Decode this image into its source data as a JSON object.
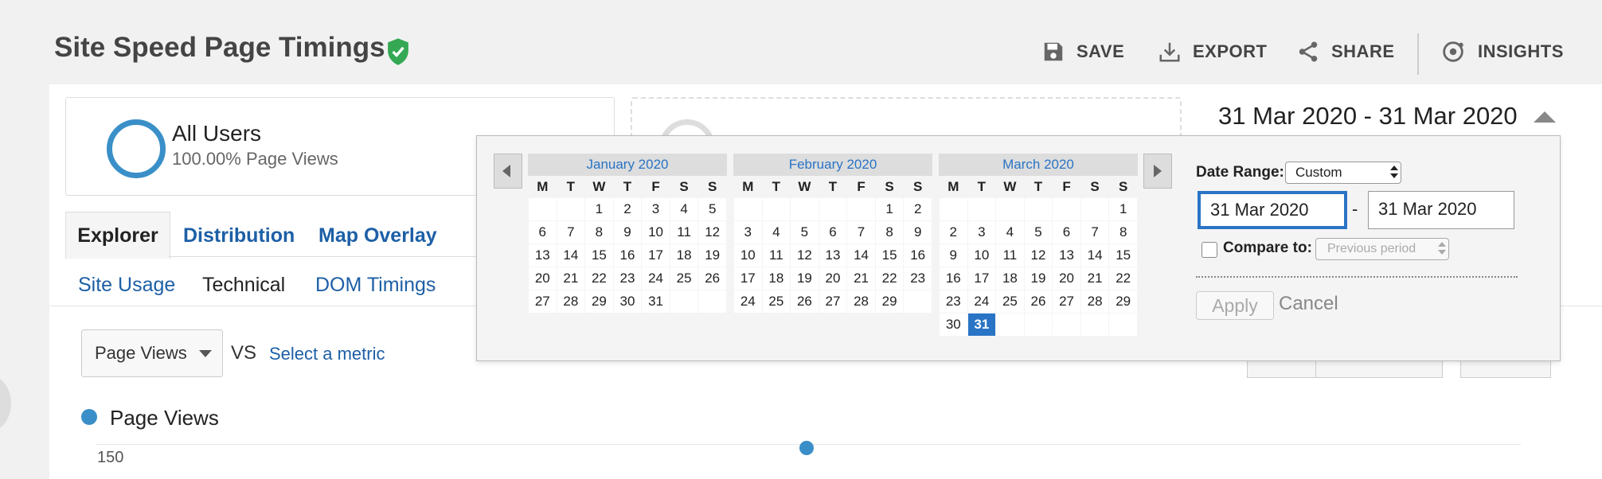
{
  "header": {
    "title": "Site Speed Page Timings",
    "toolbar": {
      "save": "SAVE",
      "export": "EXPORT",
      "share": "SHARE",
      "insights": "INSIGHTS"
    }
  },
  "segment": {
    "name": "All Users",
    "subtitle": "100.00% Page Views"
  },
  "date_range": {
    "display": "31 Mar 2020 - 31 Mar 2020"
  },
  "tabs": [
    "Explorer",
    "Distribution",
    "Map Overlay"
  ],
  "subtabs": [
    "Site Usage",
    "Technical",
    "DOM Timings"
  ],
  "metric": {
    "selected": "Page Views",
    "vs": "VS",
    "select_metric": "Select a metric"
  },
  "chart": {
    "legend": "Page Views",
    "y_tick": "150"
  },
  "picker": {
    "weekdays": [
      "M",
      "T",
      "W",
      "T",
      "F",
      "S",
      "S"
    ],
    "months": [
      {
        "title": "January 2020",
        "weeks": [
          [
            "",
            "",
            "1",
            "2",
            "3",
            "4",
            "5"
          ],
          [
            "6",
            "7",
            "8",
            "9",
            "10",
            "11",
            "12"
          ],
          [
            "13",
            "14",
            "15",
            "16",
            "17",
            "18",
            "19"
          ],
          [
            "20",
            "21",
            "22",
            "23",
            "24",
            "25",
            "26"
          ],
          [
            "27",
            "28",
            "29",
            "30",
            "31",
            "",
            ""
          ]
        ]
      },
      {
        "title": "February 2020",
        "weeks": [
          [
            "",
            "",
            "",
            "",
            "",
            "1",
            "2"
          ],
          [
            "3",
            "4",
            "5",
            "6",
            "7",
            "8",
            "9"
          ],
          [
            "10",
            "11",
            "12",
            "13",
            "14",
            "15",
            "16"
          ],
          [
            "17",
            "18",
            "19",
            "20",
            "21",
            "22",
            "23"
          ],
          [
            "24",
            "25",
            "26",
            "27",
            "28",
            "29",
            ""
          ]
        ]
      },
      {
        "title": "March 2020",
        "weeks": [
          [
            "",
            "",
            "",
            "",
            "",
            "",
            "1"
          ],
          [
            "2",
            "3",
            "4",
            "5",
            "6",
            "7",
            "8"
          ],
          [
            "9",
            "10",
            "11",
            "12",
            "13",
            "14",
            "15"
          ],
          [
            "16",
            "17",
            "18",
            "19",
            "20",
            "21",
            "22"
          ],
          [
            "23",
            "24",
            "25",
            "26",
            "27",
            "28",
            "29"
          ],
          [
            "30",
            "31",
            "",
            "",
            "",
            "",
            ""
          ]
        ],
        "selected_day": "31"
      }
    ],
    "date_range_label": "Date Range:",
    "date_range_value": "Custom",
    "from": "31 Mar 2020",
    "separator": "-",
    "to": "31 Mar 2020",
    "compare_label": "Compare to:",
    "compare_value": "Previous period",
    "compare_checked": false,
    "apply": "Apply",
    "cancel": "Cancel"
  },
  "colors": {
    "accent": "#2a74c5",
    "series": "#3a8fc8",
    "verified": "#34a853",
    "link": "#1d5fa6"
  },
  "icons": [
    "verified-shield-icon",
    "save-disk-icon",
    "export-download-icon",
    "share-icon",
    "insights-icon",
    "prev-month-arrow-icon",
    "next-month-arrow-icon"
  ]
}
